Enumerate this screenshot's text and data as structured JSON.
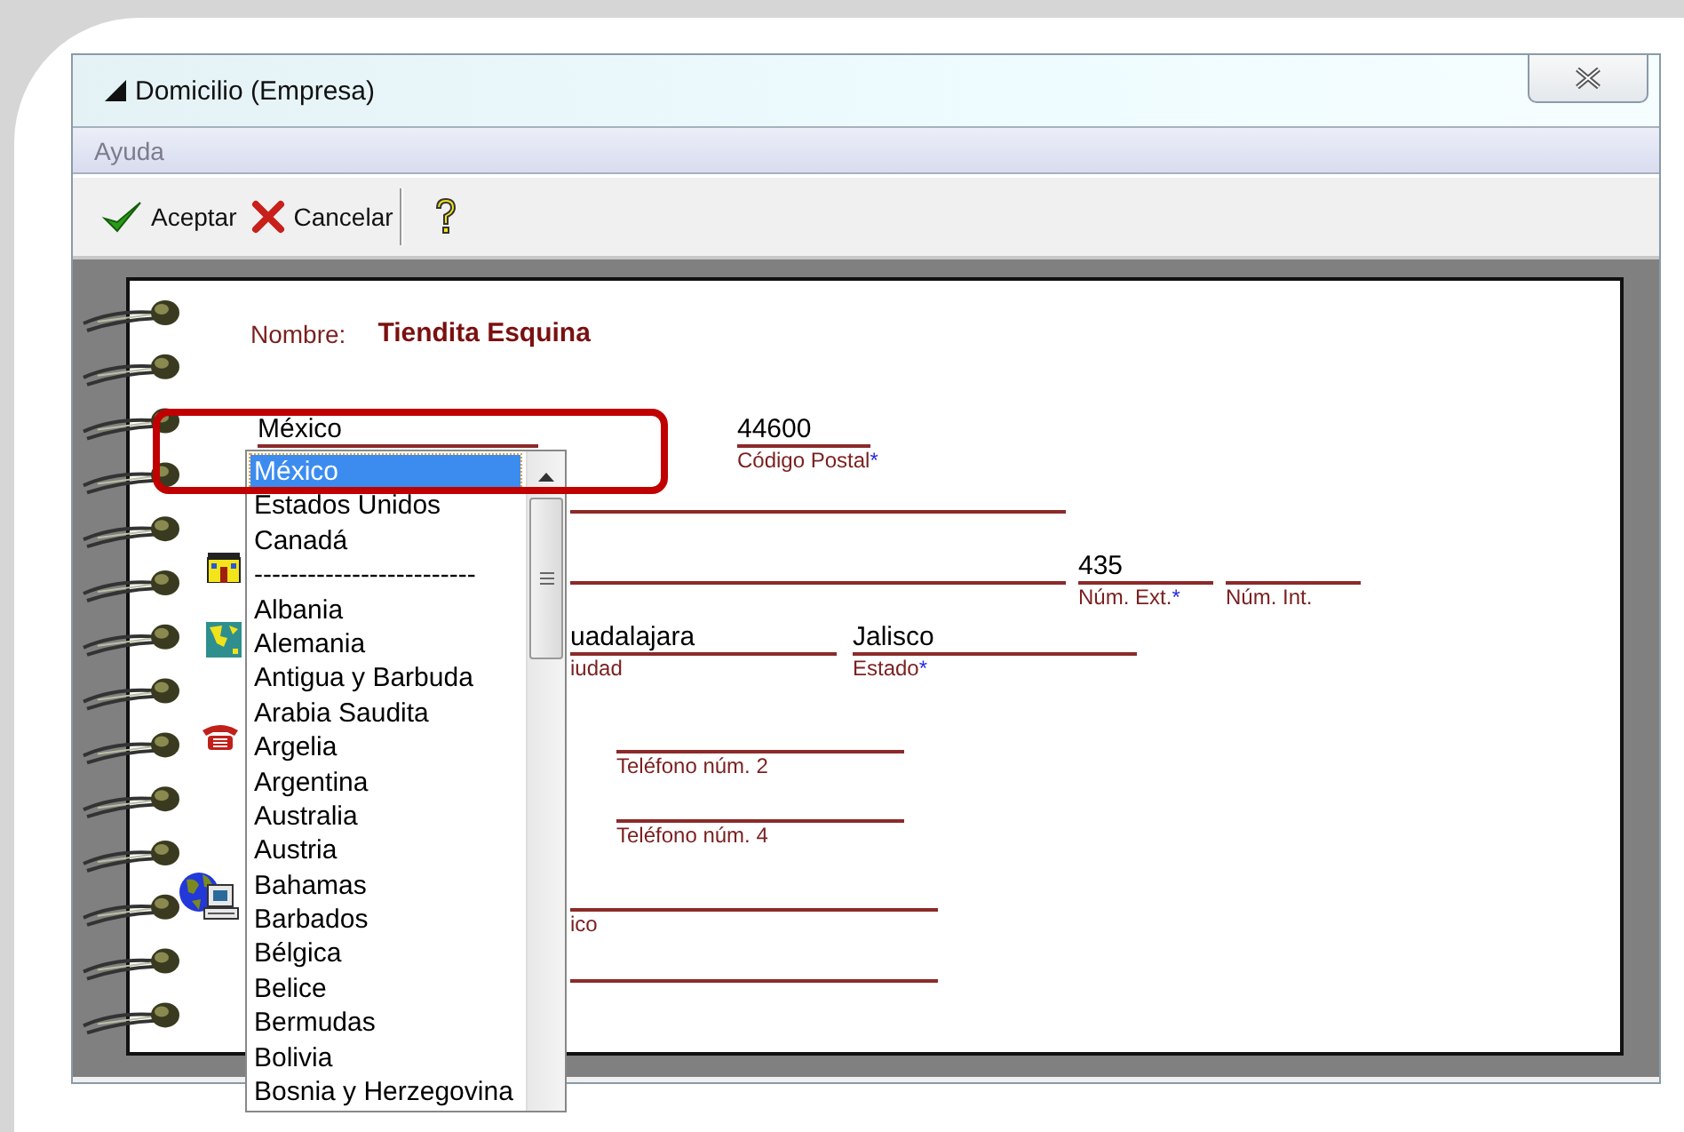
{
  "window": {
    "title": "Domicilio (Empresa)"
  },
  "menu": [
    {
      "label": "Ayuda",
      "disabled": true
    }
  ],
  "toolbar": [
    {
      "kind": "accept",
      "label": "Aceptar"
    },
    {
      "kind": "cancel",
      "label": "Cancelar"
    },
    {
      "kind": "help"
    }
  ],
  "form": {
    "name_label": "Nombre:",
    "name_value": "Tiendita Esquina",
    "fields": [
      {
        "value": "México"
      },
      {
        "value": "44600",
        "label": "Código Postal",
        "required_mark": "*"
      },
      {
        "value": "435",
        "label": "Núm. Ext.",
        "required_mark": "*"
      },
      {
        "label": "Núm. Int."
      },
      {
        "value": "uadalajara",
        "label": "iudad"
      },
      {
        "value": "Jalisco",
        "label": "Estado",
        "required_mark": "*"
      },
      {
        "label": "Teléfono núm. 2"
      },
      {
        "label": "Teléfono núm. 4"
      },
      {
        "label": "ico"
      }
    ]
  },
  "dropdown": {
    "items": [
      {
        "label": "México",
        "selected": true
      },
      {
        "label": "Estados Unidos",
        "selected": false
      },
      {
        "label": "Canadá",
        "selected": false
      },
      {
        "label": "-------------------------",
        "selected": false
      },
      {
        "label": "Albania",
        "selected": false
      },
      {
        "label": "Alemania",
        "selected": false
      },
      {
        "label": "Antigua y Barbuda",
        "selected": false
      },
      {
        "label": "Arabia Saudita",
        "selected": false
      },
      {
        "label": "Argelia",
        "selected": false
      },
      {
        "label": "Argentina",
        "selected": false
      },
      {
        "label": "Australia",
        "selected": false
      },
      {
        "label": "Austria",
        "selected": false
      },
      {
        "label": "Bahamas",
        "selected": false
      },
      {
        "label": "Barbados",
        "selected": false
      },
      {
        "label": "Bélgica",
        "selected": false
      },
      {
        "label": "Belice",
        "selected": false
      },
      {
        "label": "Bermudas",
        "selected": false
      },
      {
        "label": "Bolivia",
        "selected": false
      },
      {
        "label": "Bosnia y Herzegovina",
        "selected": false
      }
    ]
  }
}
